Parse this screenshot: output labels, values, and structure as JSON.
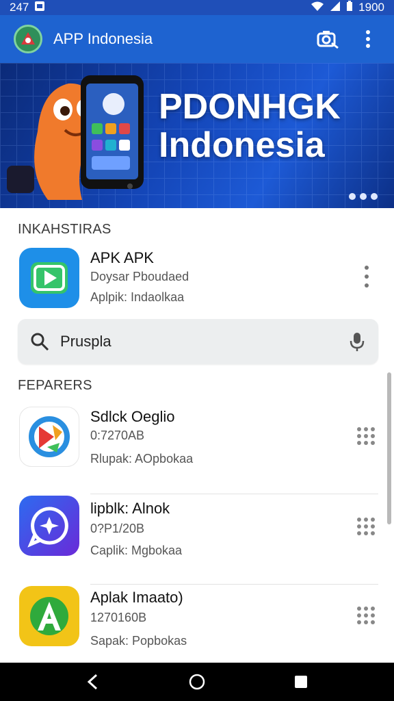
{
  "status_bar": {
    "time": "247",
    "right_text": "1900"
  },
  "app_bar": {
    "title": "APP Indonesia"
  },
  "banner": {
    "line1": "PDONHGK",
    "line2": "Indonesia"
  },
  "featured": {
    "heading": "INKAHSTIRAS",
    "app": {
      "name": "APK APK",
      "line1": "Doysar Pboudaed",
      "line2": "Aplpik: Indaolkaa"
    }
  },
  "search": {
    "value": "Pruspla",
    "placeholder": "Pruspla"
  },
  "list": {
    "heading": "FEPARERS",
    "items": [
      {
        "name": "Sdlck Oeglio",
        "size": "0:7270AB",
        "meta": "Rlupak: AOpbokaa",
        "icon_color": "#ffffff"
      },
      {
        "name": "lipblk: Alnok",
        "size": "0?P1/20B",
        "meta": "Caplik: Mgbokaa",
        "icon_color": "#3b3fd8"
      },
      {
        "name": "Aplak Imaato)",
        "size": "1270160B",
        "meta": "Sapak: Popbokas",
        "icon_color": "#f2c417"
      }
    ]
  },
  "colors": {
    "primary": "#1e63d0",
    "status": "#1f4fb8"
  }
}
